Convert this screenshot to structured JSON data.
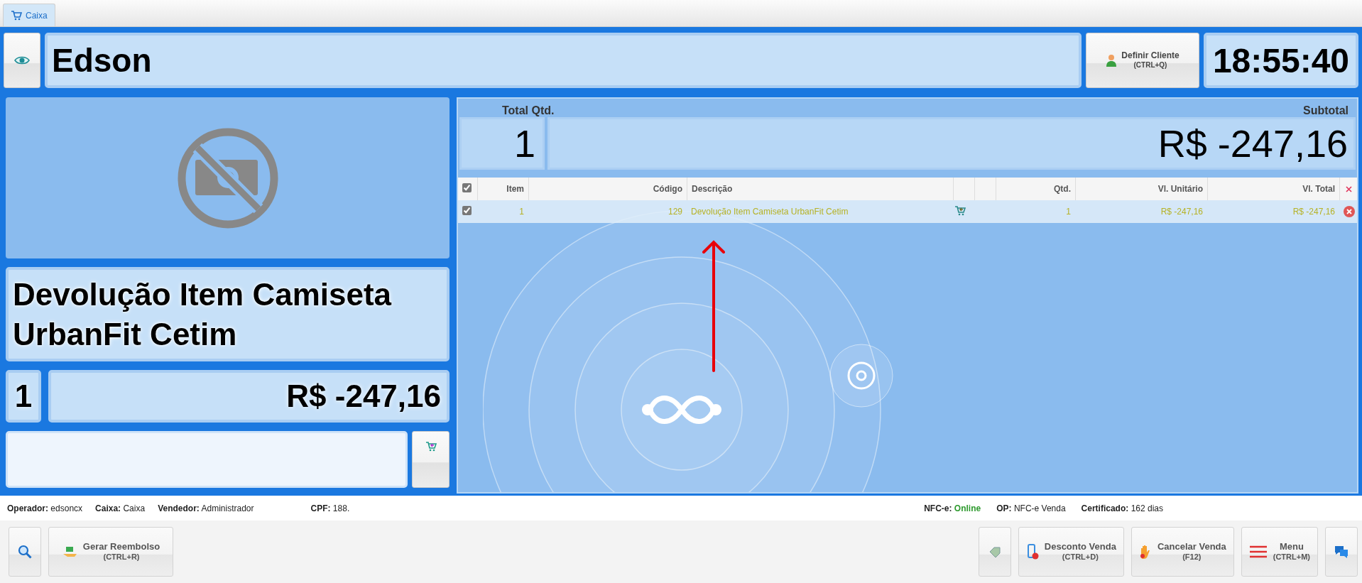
{
  "tab": {
    "label": "Caixa",
    "selected": true
  },
  "header": {
    "operator_name": "Edson",
    "client_button": {
      "label": "Definir Cliente",
      "shortcut": "(CTRL+Q)"
    },
    "clock": "18:55:40"
  },
  "product": {
    "description": "Devolução Item Camiseta UrbanFit Cetim",
    "quantity": "1",
    "price": "R$ -247,16"
  },
  "totals": {
    "qty_label": "Total Qtd.",
    "qty": "1",
    "subtotal_label": "Subtotal",
    "subtotal": "R$ -247,16"
  },
  "table": {
    "all_checked": true,
    "columns": [
      "Item",
      "Código",
      "Descrição",
      "Qtd.",
      "Vl. Unitário",
      "Vl. Total"
    ],
    "rows": [
      {
        "checked": true,
        "item": "1",
        "code": "129",
        "description": "Devolução Item Camiseta UrbanFit Cetim",
        "qty": "1",
        "unit_price": "R$ -247,16",
        "total": "R$ -247,16"
      }
    ]
  },
  "status_left": [
    {
      "label": "Operador:",
      "value": "edsoncx"
    },
    {
      "label": "Caixa:",
      "value": "Caixa"
    },
    {
      "label": "Vendedor:",
      "value": "Administrador"
    },
    {
      "label": "CPF:",
      "value": "188."
    }
  ],
  "status_right": [
    {
      "label": "NFC-e:",
      "value": "Online",
      "online": true
    },
    {
      "label": "OP:",
      "value": "NFC-e Venda"
    },
    {
      "label": "Certificado:",
      "value": "162 dias"
    }
  ],
  "toolbar_left": [
    {
      "label": "Gerar Reembolso",
      "shortcut": "(CTRL+R)"
    }
  ],
  "toolbar_right": [
    {
      "label": "Desconto Venda",
      "shortcut": "(CTRL+D)"
    },
    {
      "label": "Cancelar Venda",
      "shortcut": "(F12)"
    },
    {
      "label": "Menu",
      "shortcut": "(CTRL+M)"
    }
  ]
}
